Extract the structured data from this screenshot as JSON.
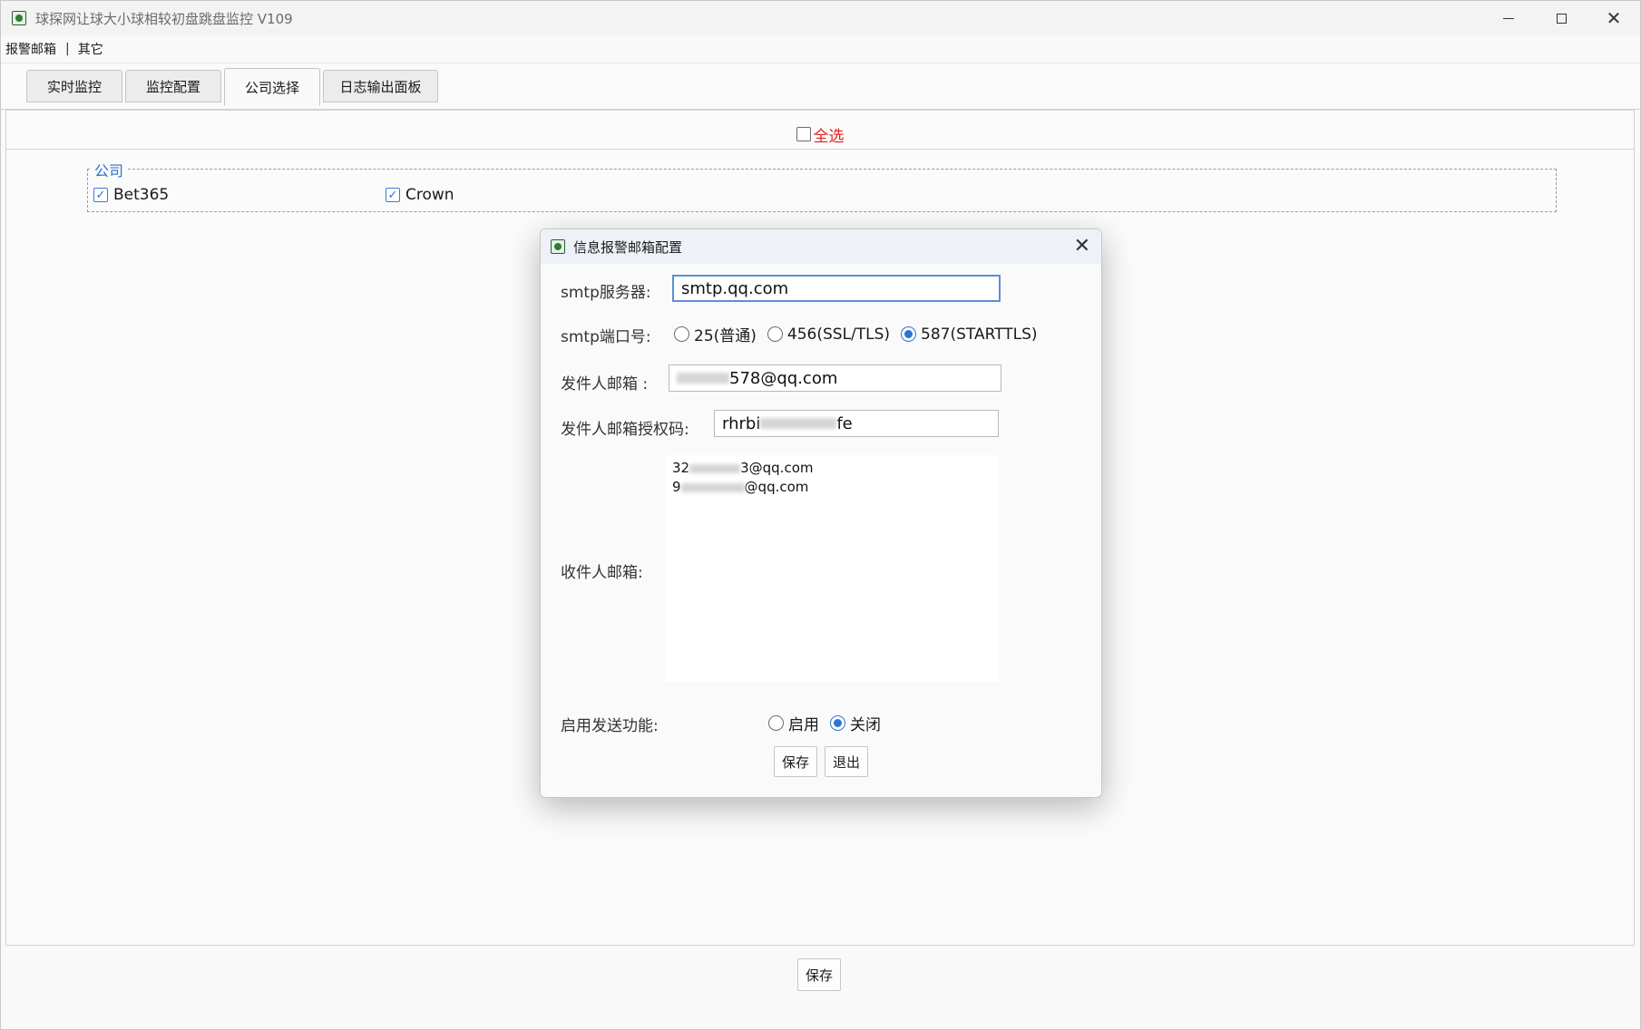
{
  "window": {
    "title": "球探网让球大小球相较初盘跳盘监控 V109"
  },
  "menu": {
    "items": [
      "报警邮箱",
      "其它"
    ],
    "separator": "|"
  },
  "tabs": [
    {
      "label": "实时监控",
      "active": false
    },
    {
      "label": "监控配置",
      "active": false
    },
    {
      "label": "公司选择",
      "active": true
    },
    {
      "label": "日志输出面板",
      "active": false
    }
  ],
  "company_panel": {
    "select_all_label": "全选",
    "select_all_checked": false,
    "group_label": "公司",
    "companies": [
      {
        "name": "Bet365",
        "checked": true
      },
      {
        "name": "Crown",
        "checked": true
      }
    ],
    "save_label": "保存"
  },
  "dialog": {
    "title": "信息报警邮箱配置",
    "smtp_server_label": "smtp服务器:",
    "smtp_server_value": "smtp.qq.com",
    "smtp_port_label": "smtp端口号:",
    "smtp_port_options": [
      {
        "label": "25(普通)",
        "selected": false
      },
      {
        "label": "456(SSL/TLS)",
        "selected": false
      },
      {
        "label": "587(STARTTLS)",
        "selected": true
      }
    ],
    "sender_label": "发件人邮箱 :",
    "sender_value_suffix": "578@qq.com",
    "auth_code_label": "发件人邮箱授权码:",
    "auth_code_prefix": "rhrbi",
    "auth_code_suffix": "fe",
    "recipients_label": "收件人邮箱:",
    "recipients": [
      {
        "prefix": "32",
        "suffix": "3@qq.com"
      },
      {
        "prefix": "9",
        "suffix": "@qq.com"
      }
    ],
    "send_label": "启用发送功能:",
    "send_options": [
      {
        "label": "启用",
        "selected": false
      },
      {
        "label": "关闭",
        "selected": true
      }
    ],
    "save_label": "保存",
    "exit_label": "退出"
  }
}
